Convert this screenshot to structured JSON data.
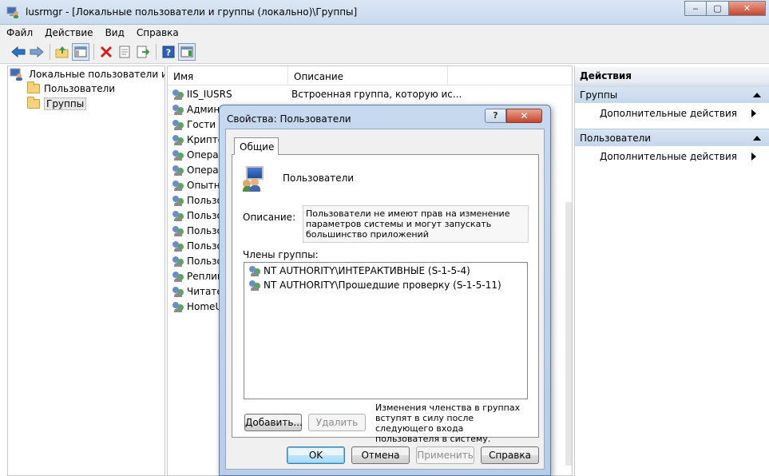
{
  "window": {
    "title": "lusrmgr - [Локальные пользователи и группы (локально)\\Группы]",
    "min_glyph": "‒",
    "max_glyph": "▢",
    "close_glyph": "✕"
  },
  "menu": [
    "Файл",
    "Действие",
    "Вид",
    "Справка"
  ],
  "toolbar": {
    "icons": [
      "back-icon",
      "forward-icon",
      "up-folder-icon",
      "show-hide-tree-icon",
      "delete-icon",
      "properties-icon",
      "export-list-icon",
      "help-icon",
      "show-action-pane-icon"
    ]
  },
  "tree": {
    "root": "Локальные пользователи и группы",
    "items": [
      "Пользователи",
      "Группы"
    ]
  },
  "list": {
    "columns": [
      "Имя",
      "Описание"
    ],
    "rows": [
      {
        "name": "IIS_IUSRS",
        "desc": "Встроенная группа, которую ис..."
      },
      {
        "name": "Админи",
        "desc": ""
      },
      {
        "name": "Гости",
        "desc": ""
      },
      {
        "name": "Криптог",
        "desc": ""
      },
      {
        "name": "Операт",
        "desc": ""
      },
      {
        "name": "Операт",
        "desc": ""
      },
      {
        "name": "Опытны",
        "desc": ""
      },
      {
        "name": "Пользо",
        "desc": ""
      },
      {
        "name": "Пользо",
        "desc": ""
      },
      {
        "name": "Пользо",
        "desc": ""
      },
      {
        "name": "Пользо",
        "desc": ""
      },
      {
        "name": "Пользо",
        "desc": ""
      },
      {
        "name": "Реплика",
        "desc": ""
      },
      {
        "name": "Читател",
        "desc": ""
      },
      {
        "name": "HomeUs",
        "desc": ""
      }
    ]
  },
  "actions": {
    "title": "Действия",
    "sections": [
      {
        "header": "Группы",
        "item": "Дополнительные действия"
      },
      {
        "header": "Пользователи",
        "item": "Дополнительные действия"
      }
    ]
  },
  "dialog": {
    "title": "Свойства: Пользователи",
    "help_glyph": "?",
    "close_glyph": "✕",
    "tab": "Общие",
    "group_name": "Пользователи",
    "description_label": "Описание:",
    "description": "Пользователи не имеют прав на изменение параметров системы и могут запускать большинство приложений",
    "members_label": "Члены группы:",
    "members": [
      "NT AUTHORITY\\ИНТЕРАКТИВНЫЕ (S-1-5-4)",
      "NT AUTHORITY\\Прошедшие проверку (S-1-5-11)"
    ],
    "note": "Изменения членства в группах вступят в силу после следующего входа пользователя в систему.",
    "buttons": {
      "add": "Добавить...",
      "remove": "Удалить",
      "ok": "OK",
      "cancel": "Отмена",
      "apply": "Применить",
      "help": "Справка"
    }
  }
}
